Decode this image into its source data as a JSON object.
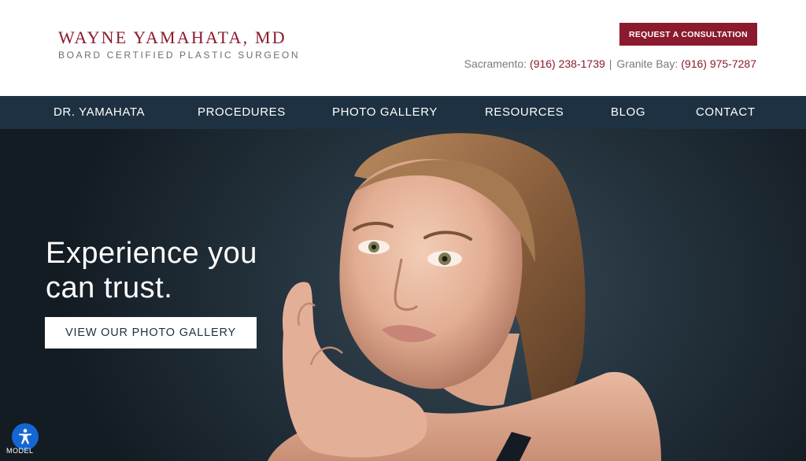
{
  "header": {
    "logo_name": "WAYNE YAMAHATA, MD",
    "logo_subtitle": "BOARD CERTIFIED PLASTIC SURGEON",
    "cta_label": "REQUEST A CONSULTATION",
    "phones": [
      {
        "location": "Sacramento:",
        "number": "(916) 238-1739"
      },
      {
        "location": "Granite Bay:",
        "number": "(916) 975-7287"
      }
    ],
    "separator": "|"
  },
  "nav": {
    "items": [
      {
        "label": "DR. YAMAHATA"
      },
      {
        "label": "PROCEDURES"
      },
      {
        "label": "PHOTO GALLERY"
      },
      {
        "label": "RESOURCES"
      },
      {
        "label": "BLOG"
      },
      {
        "label": "CONTACT"
      }
    ]
  },
  "hero": {
    "title_line1": "Experience you",
    "title_line2": "can trust.",
    "button_label": "VIEW OUR PHOTO GALLERY"
  },
  "accessibility": {
    "icon": "accessibility-person-icon",
    "label": "MODEL"
  },
  "colors": {
    "brand": "#8b1a2d",
    "nav_bg": "#1d3142",
    "accessibility": "#1467d3"
  }
}
